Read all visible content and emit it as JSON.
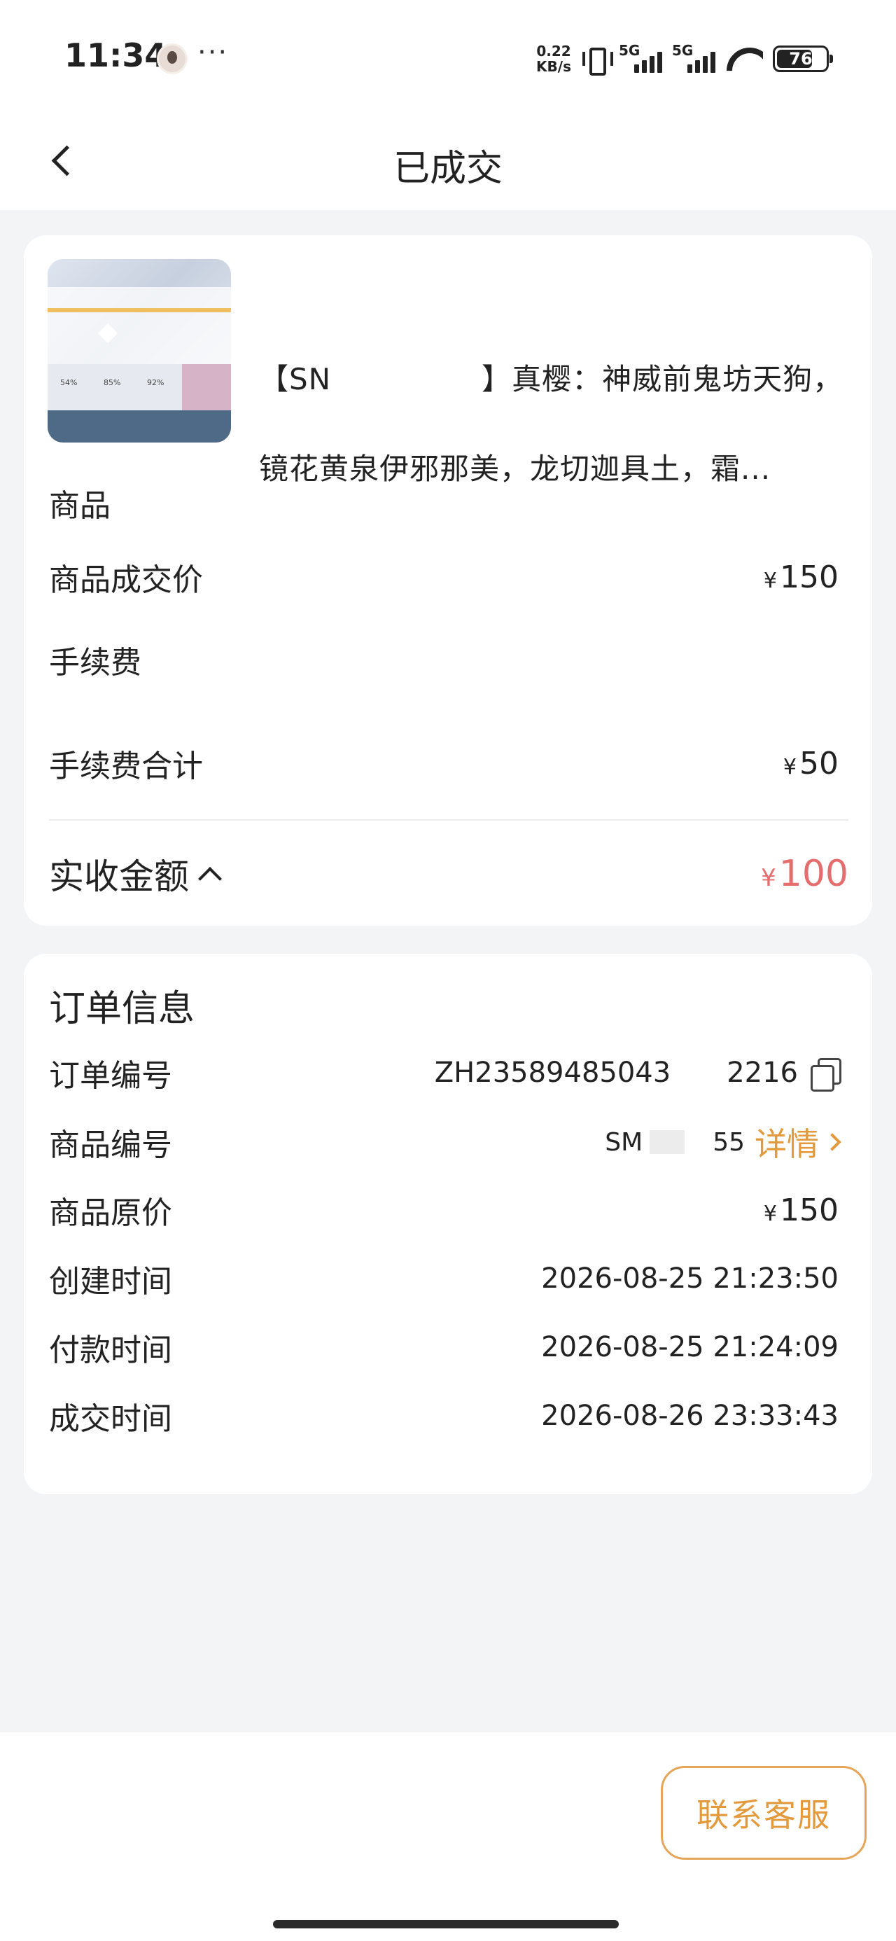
{
  "status_bar": {
    "time": "11:34",
    "more": "···",
    "net_speed_value": "0.22",
    "net_speed_unit": "KB/s",
    "sim1_label": "5G",
    "sim2_label": "5G",
    "battery": "76",
    "battery_level": 0.76
  },
  "header": {
    "title": "已成交"
  },
  "goods": {
    "title_line1": "【SN     】真樱：神威前鬼坊天狗，",
    "title_line2": "镜花黄泉伊邪那美，龙切迦具土，霜...",
    "thumb_pcts": [
      "54%",
      "85%",
      "92%"
    ],
    "section_label": "商品",
    "deal_price_label": "商品成交价",
    "deal_price_currency": "¥",
    "deal_price": "150",
    "fee_section_label": "手续费",
    "fee_total_label": "手续费合计",
    "fee_currency": "¥",
    "fee_total": "50",
    "net_label": "实收金额",
    "net_currency": "¥",
    "net_amount": "100"
  },
  "order": {
    "title": "订单信息",
    "order_no_label": "订单编号",
    "order_no_prefix": "ZH23589485043",
    "order_no_suffix": "2216",
    "goods_no_label": "商品编号",
    "goods_no_prefix": "SM",
    "goods_no_suffix": "55",
    "detail_link": "详情",
    "orig_price_label": "商品原价",
    "orig_price_currency": "¥",
    "orig_price": "150",
    "created_label": "创建时间",
    "created_at": "2026-08-25 21:23:50",
    "paid_label": "付款时间",
    "paid_at": "2026-08-25 21:24:09",
    "deal_label": "成交时间",
    "deal_at": "2026-08-26 23:33:43"
  },
  "footer": {
    "contact_button": "联系客服"
  },
  "colors": {
    "accent": "#e39a3c",
    "net_amount": "#e46d6d",
    "background": "#f3f4f6"
  }
}
